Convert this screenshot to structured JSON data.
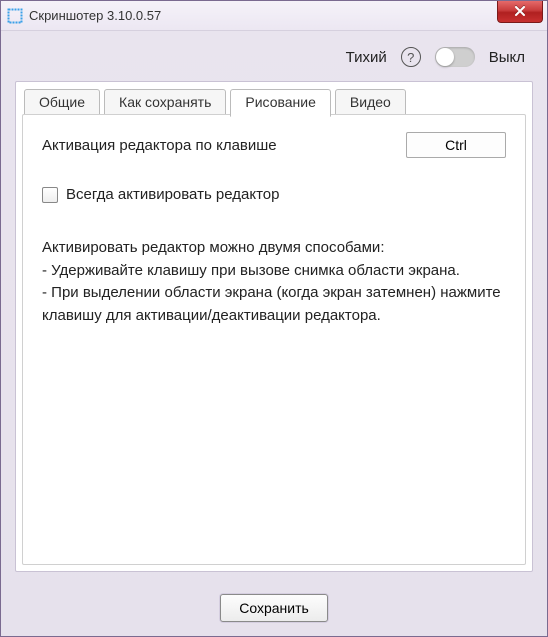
{
  "window": {
    "title": "Скриншотер 3.10.0.57"
  },
  "header": {
    "quiet_label": "Тихий",
    "toggle_state_label": "Выкл"
  },
  "tabs": {
    "general": "Общие",
    "save": "Как сохранять",
    "drawing": "Рисование",
    "video": "Видео"
  },
  "drawing": {
    "activation_label": "Активация редактора по клавише",
    "activation_key": "Ctrl",
    "always_activate_label": "Всегда активировать редактор",
    "help_line1": "Активировать редактор можно двумя способами:",
    "help_line2": "- Удерживайте клавишу при вызове снимка области экрана.",
    "help_line3": "- При выделении области экрана (когда экран затемнен) нажмите клавишу для активации/деактивации редактора."
  },
  "footer": {
    "save_label": "Сохранить"
  }
}
